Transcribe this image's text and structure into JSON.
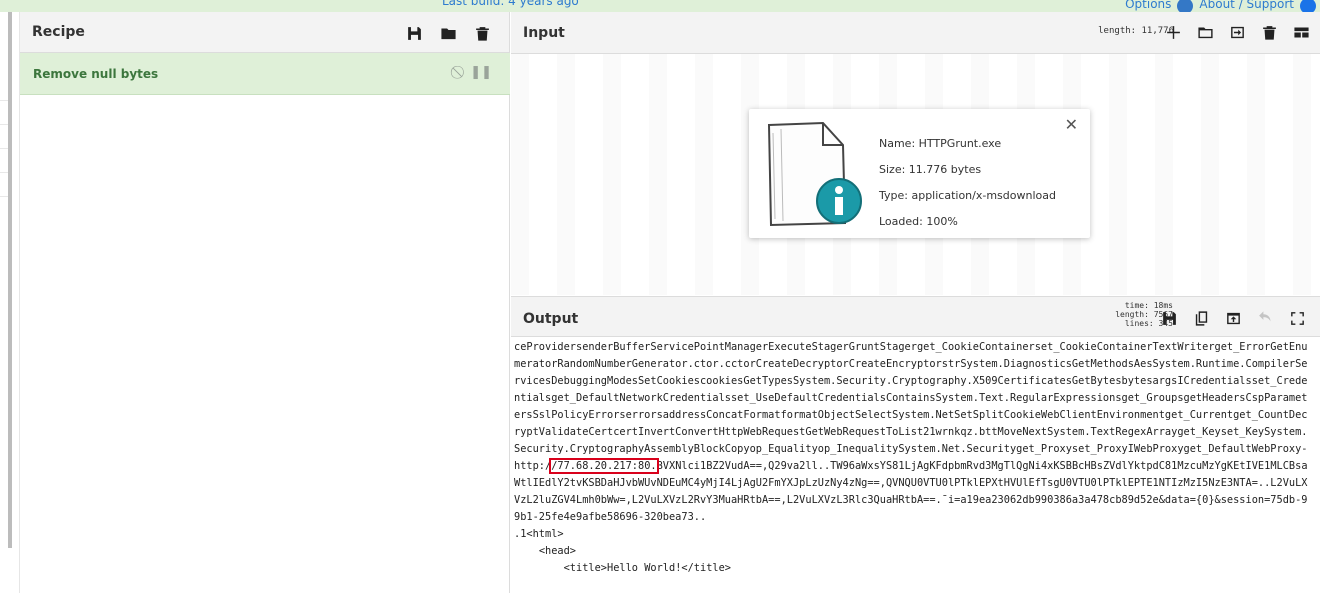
{
  "banner": {
    "build_text": "Last build: 4 years ago",
    "options_label": "Options",
    "about_label": "About / Support"
  },
  "recipe": {
    "title": "Recipe",
    "operations": [
      {
        "name": "Remove null bytes",
        "disable_icon": "disable-icon",
        "pause_icon": "pause-icon"
      }
    ]
  },
  "input": {
    "title": "Input",
    "length_text": "length: 11,776",
    "file": {
      "name_line": "Name: HTTPGrunt.exe",
      "size_line": "Size: 11.776 bytes",
      "type_line": "Type: application/x-msdownload",
      "loaded_line": "Loaded: 100%"
    }
  },
  "output": {
    "title": "Output",
    "time_text": "time: 18ms",
    "length_text": "length: 7567",
    "lines_text": "lines: 345",
    "text_before": "ceProvidersenderBufferServicePointManagerExecuteStagerGruntStagerget_CookieContainerset_CookieContainerTextWriterget_ErrorGetEnumeratorRandomNumberGenerator.ctor.cctorCreateDecryptorCreateEncryptorstrSystem.DiagnosticsGetMethodsAesSystem.Runtime.CompilerServicesDebuggingModesSetCookiescookiesGetTypesSystem.Security.Cryptography.X509CertificatesGetBytesbytesargsICredentialsset_Credentialsget_DefaultNetworkCredentialsset_UseDefaultCredentialsContainsSystem.Text.RegularExpressionsget_GroupsgetHeadersCspParametersSslPolicyErrorserrorsaddressConcatFormatformatObjectSelectSystem.NetSetSplitCookieWebClientEnvironmentget_Currentget_CountDecryptValidateCertcertInvertConvertHttpWebRequestGetWebRequestToList21wrnkqz.bttMoveNextSystem.TextRegexArrayget_Keyset_KeySystem.Security.CryptographyAssemblyBlockCopyop_Equalityop_InequalitySystem.Net.Securityget_Proxyset_ProxyIWebProxyget_DefaultWebProxy-\nhttp:/",
    "highlighted": "/77.68.20.217:80.",
    "text_after": "BVXNlci1BZ2VudA==,Q29va2ll..TW96aWxsYS81LjAgKFdpbmRvd3MgTlQgNi4xKSBBcHBsZVdlYktpdC81MzcuMzYgKEtIVE1MLCBsaWtlIEdlY2tvKSBDaHJvbWUvNDEuMC4yMjI4LjAgU2FmYXJpLzUzNy4zNg==,QVNQU0VTU0lPTklEPXtHVUlEfTsgU0VTU0lPTklEPTE1NTIzMzI5NzE3NTA=..L2VuLXVzL2luZGV4Lmh0bWw=,L2VuLXVzL2RvY3MuaHRtbA==,L2VuLXVzL3Rlc3QuaHRtbA==.¯i=a19ea23062db990386a3a478cb89d52e&data={0}&session=75db-99b1-25fe4e9afbe58696-320bea73..\n.1<html>\n    <head>\n        <title>Hello World!</title>"
  }
}
